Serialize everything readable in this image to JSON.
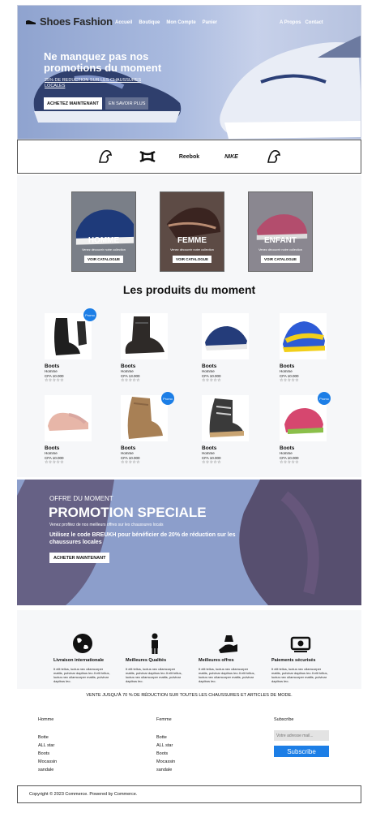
{
  "header": {
    "logo_text": "Shoes Fashion",
    "nav_links": [
      "Accueil",
      "Boutique",
      "Mon Compte",
      "Panier"
    ],
    "nav_right": [
      "A Propos",
      "Contact"
    ]
  },
  "hero": {
    "title": "Ne manquez pas nos promotions du moment",
    "subtitle": "25% DE REDUCTION SUR LES CHAUSSURES LOCALES",
    "shop_button": "ACHETEZ MAINTENANT",
    "more_button": "EN SAVOIR PLUS"
  },
  "brands": {
    "reebok": "Reebok",
    "nike": "NIKE"
  },
  "categories": [
    {
      "title": "HOMME",
      "desc": "Venez découvrir notre collection",
      "button": "VOIR CATALOGUE"
    },
    {
      "title": "FEMME",
      "desc": "Venez découvrir notre collection",
      "button": "VOIR CATALOGUE"
    },
    {
      "title": "ENFANT",
      "desc": "Venez découvrir notre collection",
      "button": "VOIR CATALOGUE"
    }
  ],
  "products_section": {
    "title": "Les produits du moment",
    "promo_label": "Promo",
    "items": [
      {
        "name": "Boots",
        "gender": "Homme",
        "price": "CFA 10.000",
        "rating": "☆☆☆☆☆",
        "promo": true
      },
      {
        "name": "Boots",
        "gender": "Homme",
        "price": "CFA 13.000",
        "rating": "☆☆☆☆☆",
        "promo": false
      },
      {
        "name": "Boots",
        "gender": "Homme",
        "price": "CFA 10.000",
        "rating": "☆☆☆☆☆",
        "promo": false
      },
      {
        "name": "Boots",
        "gender": "Homme",
        "price": "CFA 10.000",
        "rating": "☆☆☆☆☆",
        "promo": false
      },
      {
        "name": "Boots",
        "gender": "Homme",
        "price": "CFA 10.000",
        "rating": "☆☆☆☆☆",
        "promo": false
      },
      {
        "name": "Boots",
        "gender": "Homme",
        "price": "CFA 10.000",
        "rating": "☆☆☆☆☆",
        "promo": true
      },
      {
        "name": "Boots",
        "gender": "Homme",
        "price": "CFA 10.000",
        "rating": "☆☆☆☆☆",
        "promo": false
      },
      {
        "name": "Boots",
        "gender": "Homme",
        "price": "CFA 10.000",
        "rating": "☆☆☆☆☆",
        "promo": true
      }
    ]
  },
  "promo_banner": {
    "kicker": "OFFRE DU MOMENT",
    "title": "PROMOTION SPECIALE",
    "subtitle": "Venez profitez de nos meilleurs offres sur les chaussures locals",
    "code_text": "Utilisez le code BREUKH pour bénéficier de 20% de réduction sur les chaussures locales",
    "button": "ACHETER MAINTENANT"
  },
  "features": [
    {
      "title": "Livraison internationale",
      "icon": "globe-icon",
      "text": "It elit tellus, luctus nec ullamcorper mattis, pulvinar dapibus leo.It elit tellus, luctus nec ullamcorper mattis, pulvinar dapibus leo."
    },
    {
      "title": "Meilleures Qualités",
      "icon": "person-icon",
      "text": "It elit tellus, luctus nec ullamcorper mattis, pulvinar dapibus leo.It elit tellus, luctus nec ullamcorper mattis, pulvinar dapibus leo."
    },
    {
      "title": "Meilleures offres",
      "icon": "hand-money-icon",
      "text": "It elit tellus, luctus nec ullamcorper mattis, pulvinar dapibus leo.It elit tellus, luctus nec ullamcorper mattis, pulvinar dapibus leo."
    },
    {
      "title": "Paiements sécurisés",
      "icon": "cash-icon",
      "text": "It elit tellus, luctus nec ullamcorper mattis, pulvinar dapibus leo.It elit tellus, luctus nec ullamcorper mattis, pulvinar dapibus leo."
    }
  ],
  "deal_line": "VENTE JUSQU'À 70 % DE RÉDUCTION SUR TOUTES LES CHAUSSURES ET ARTICLES DE MODE.",
  "footer": {
    "col1": {
      "heading": "Homme",
      "links": [
        "Botte",
        "ALL star",
        "Boots",
        "Mocassin",
        "sandale"
      ]
    },
    "col2": {
      "heading": "Femme",
      "links": [
        "Botte",
        "ALL star",
        "Boots",
        "Mocassin",
        "sandale"
      ]
    },
    "subscribe": {
      "heading": "Subscribe",
      "placeholder": "Votre adresse mail...",
      "button": "Subscribe"
    }
  },
  "copyright": "Copyright © 2023 Commerce. Powered by Commerce.",
  "colors": {
    "accent": "#1c7ee6",
    "hero_bg": "#a9badf",
    "section_bg": "#f6f7f9"
  }
}
